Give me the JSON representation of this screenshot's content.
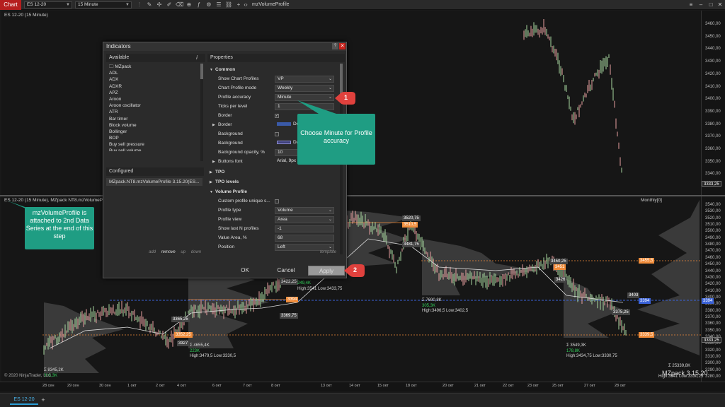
{
  "toolbar": {
    "app_label": "Chart",
    "instrument": "ES 12-20",
    "interval": "15 Minute",
    "title": "mzVolumeProfile",
    "tab_label": "ES 12-20",
    "add_tab": "+"
  },
  "top_panel": {
    "label": "ES 12-20 (15 Minute)",
    "y_ticks": [
      "3460,00",
      "3450,00",
      "3440,00",
      "3430,00",
      "3420,00",
      "3410,00",
      "3400,00",
      "3390,00",
      "3380,00",
      "3370,00",
      "3360,00",
      "3350,00",
      "3340,00"
    ],
    "last_price": "3333,25"
  },
  "bottom_panel": {
    "label": "ES 12-20 (15 Minute), MZpack NT8.mzVolumeProfile 3",
    "right_label": "Monthly[0]",
    "y_ticks": [
      "3540,00",
      "3530,00",
      "3520,00",
      "3510,00",
      "3500,00",
      "3490,00",
      "3480,00",
      "3470,00",
      "3460,00",
      "3450,00",
      "3440,00",
      "3430,00",
      "3420,00",
      "3410,00",
      "3400,00",
      "3390,00",
      "3380,00",
      "3370,00",
      "3360,00",
      "3350,00",
      "3340,00",
      "3330,00",
      "3320,00",
      "3310,00",
      "3300,00",
      "3290,00",
      "3280,00"
    ],
    "last_price": "3333,25",
    "blue_price": "3394",
    "tags": {
      "t1": "3520,75",
      "t2": "3510,5",
      "t3": "3481,75",
      "t4": "3450,25",
      "t5": "3451",
      "t6": "3455,5",
      "t7": "3426",
      "t8": "3403",
      "t9": "3394",
      "t10": "3375,25",
      "t11": "3339,5",
      "t12": "3422,25",
      "t13": "3394",
      "t14": "3369,75",
      "t15": "3365,25",
      "t16": "3352,25",
      "t17": "3327"
    },
    "stats": {
      "s1_a": "Σ 7690,8K",
      "s1_b": "305,3K",
      "s1_c": "High:3496,5 Low:3402,5",
      "s2_a": "Σ 4655,4K",
      "s2_b": "223K",
      "s2_c": "High:3479,5 Low:3330,5",
      "s3_a": "Σ 3549,3K",
      "s3_b": "178,8K",
      "s3_c": "High:3434,75 Low:3330,75",
      "s4_a": "Σ 8345,2K",
      "s4_b": "316,3K",
      "s5_b": "249,4K",
      "s5_c": "High:3541 Low:3433,75",
      "s6_a": "Σ 25339,8K",
      "s6_b": "High:3541 Low:3330,25"
    },
    "watermark": "MZpack 3.15.20",
    "copyright": "© 2020 NinjaTrader, LLC"
  },
  "x_ticks": [
    "28 сен",
    "29 сен",
    "30 сен",
    "1 окт",
    "2 окт",
    "4 окт",
    "6 окт",
    "7 окт",
    "8 окт",
    "13 окт",
    "14 окт",
    "15 окт",
    "18 окт",
    "20 окт",
    "21 окт",
    "22 окт",
    "23 окт",
    "25 окт",
    "27 окт",
    "28 окт"
  ],
  "dialog": {
    "title": "Indicators",
    "help": "?",
    "close": "✕",
    "available_header": "Available",
    "available_info": "i",
    "available_items": [
      "MZpack",
      "ADL",
      "ADX",
      "ADXR",
      "APZ",
      "Aroon",
      "Aroon oscillator",
      "ATR",
      "Bar timer",
      "Block volume",
      "Bollinger",
      "BOP",
      "Buy sell pressure",
      "Buy sell volume"
    ],
    "configured_header": "Configured",
    "configured_item": "MZpack.NT8.mzVolumeProfile 3.15.20(ES...",
    "links": {
      "add": "add",
      "remove": "remove",
      "up": "up",
      "down": "down"
    },
    "properties_header": "Properties",
    "template_link": "template",
    "props": {
      "common": "Common",
      "show_profiles_label": "Show Chart Profiles",
      "show_profiles_value": "VP",
      "profile_mode_label": "Chart Profile mode",
      "profile_mode_value": "Weekly",
      "accuracy_label": "Profile accuracy",
      "accuracy_value": "Minute",
      "ticks_label": "Ticks per level",
      "ticks_value": "1",
      "border_chk_label": "Border",
      "border_label": "Border",
      "border_value": "Do",
      "background_chk_label": "Background",
      "background_label": "Background",
      "background_value": "Da",
      "bg_opacity_label": "Background opacity, %",
      "bg_opacity_value": "10",
      "buttons_font_label": "Buttons font",
      "buttons_font_value": "Arial, 9px",
      "tpo": "TPO",
      "tpo_levels": "TPO levels",
      "volume_profile": "Volume Profile",
      "custom_label": "Custom profile unique s...",
      "profile_type_label": "Profile type",
      "profile_type_value": "Volume",
      "profile_view_label": "Profile view",
      "profile_view_value": "Area",
      "lastn_label": "Show last N profiles",
      "lastn_value": "-1",
      "va_label": "Value Area, %",
      "va_value": "68",
      "position_label": "Position",
      "position_value": "Left"
    },
    "buttons": {
      "ok": "OK",
      "cancel": "Cancel",
      "apply": "Apply"
    }
  },
  "callouts": {
    "minute": "Choose Minute for Profile accuracy",
    "attached": "mzVolumeProfile is attached to 2nd Data Series at the end of this step",
    "marker1": "1",
    "marker2": "2"
  },
  "colors": {
    "accent_red": "#b51f1f",
    "callout": "#1f9d83",
    "marker": "#e0413d",
    "price_orange": "#f08c3a",
    "blue_line": "#3a62d8"
  }
}
